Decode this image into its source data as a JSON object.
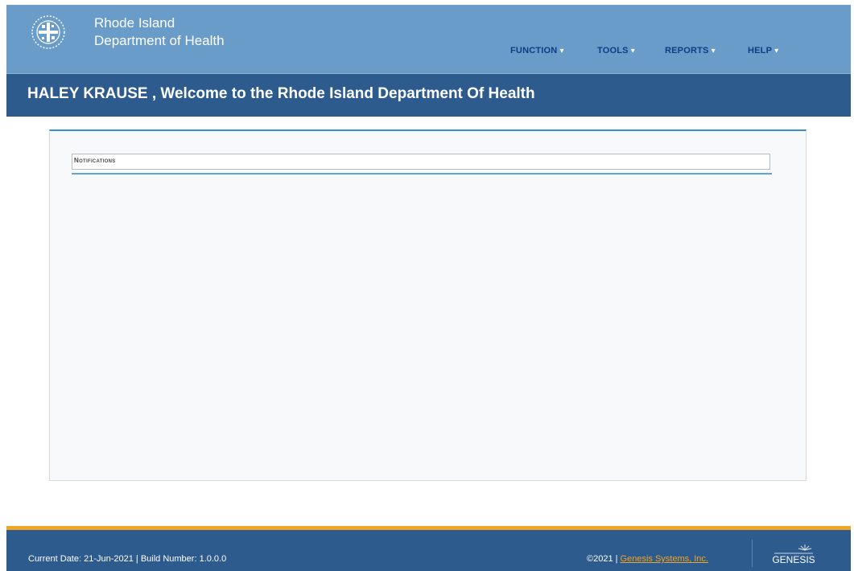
{
  "header": {
    "brand_line1": "Rhode Island",
    "brand_line2": "Department of Health",
    "logo_icon": "ri-health-seal-icon",
    "nav": [
      {
        "label": "FUNCTION"
      },
      {
        "label": "TOOLS"
      },
      {
        "label": "REPORTS"
      },
      {
        "label": "HELP"
      }
    ],
    "nav_caret": "▾"
  },
  "welcome": {
    "text": "HALEY KRAUSE , Welcome to the Rhode Island Department Of Health"
  },
  "main": {
    "notifications_title": "Notifications"
  },
  "footer": {
    "status_text": "Current Date: 21-Jun-2021 | Build Number: 1.0.0.0",
    "copyright": "©2021 | ",
    "company_link": "Genesis Systems, Inc.",
    "logo_text": "GENESIS"
  },
  "colors": {
    "header_bg": "#6a9cc9",
    "banner_bg": "#2e5b8e",
    "nav_text": "#0d3d86",
    "accent_orange": "#f0a525",
    "panel_rule": "#3a8fd0"
  }
}
